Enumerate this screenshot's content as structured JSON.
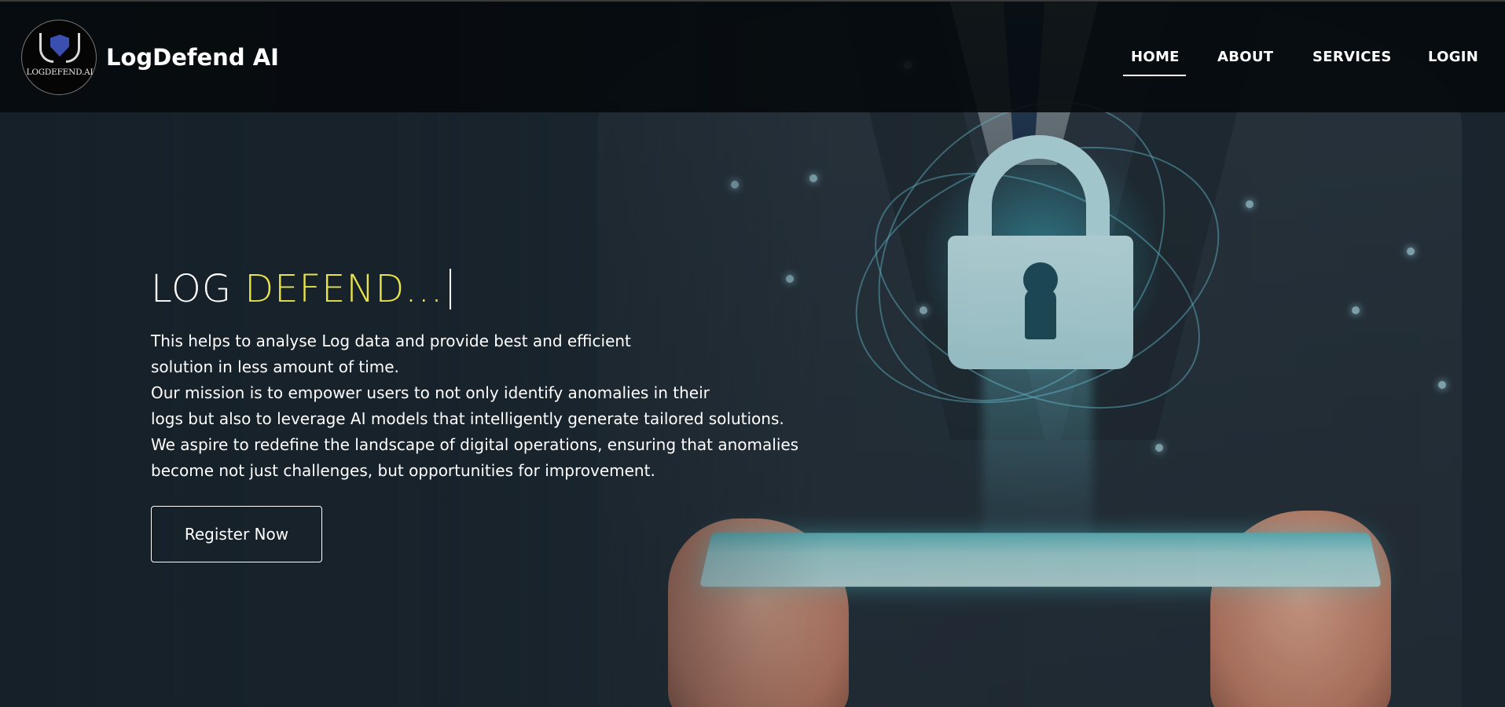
{
  "brand": {
    "logo_text": "LOGDEFEND.AI",
    "name": "LogDefend AI"
  },
  "nav": {
    "items": [
      {
        "label": "HOME",
        "active": true
      },
      {
        "label": "ABOUT",
        "active": false
      },
      {
        "label": "SERVICES",
        "active": false
      },
      {
        "label": "LOGIN",
        "active": false
      }
    ]
  },
  "hero": {
    "title_part1": "LOG ",
    "title_part2": "DEFEND...",
    "description_lines": [
      "This helps to analyse Log data and provide best and efficient",
      "solution in less amount of time.",
      "Our mission is to empower users to not only identify anomalies in their",
      "logs but also to leverage AI models that intelligently generate tailored solutions.",
      "We aspire to redefine the landscape of digital operations, ensuring that anomalies",
      "become not just challenges, but opportunities for improvement."
    ],
    "cta_label": "Register Now"
  },
  "colors": {
    "accent": "#e7e34a",
    "navbar_bg": "#06090c",
    "text": "#ffffff"
  },
  "icons": {
    "logo": "shield-laurel-icon",
    "hero_image": "padlock-tablet-illustration"
  }
}
